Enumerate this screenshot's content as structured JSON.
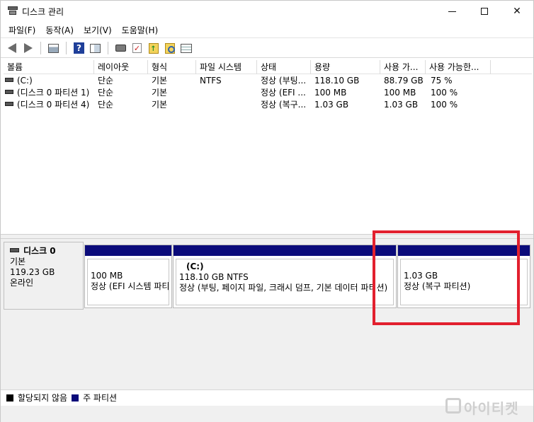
{
  "window": {
    "title": "디스크 관리",
    "controls": {
      "minimize": "—",
      "maximize": "☐",
      "close": "✕"
    }
  },
  "menu": [
    "파일(F)",
    "동작(A)",
    "보기(V)",
    "도움말(H)"
  ],
  "toolbar": {
    "icons": [
      "back-arrow-icon",
      "forward-arrow-icon",
      "console-tree-icon",
      "help-icon",
      "properties-icon",
      "connect-disk-icon",
      "check-icon",
      "up-folder-icon",
      "find-folder-icon",
      "list-view-icon"
    ]
  },
  "volume_list": {
    "columns": [
      "볼륨",
      "레이아웃",
      "형식",
      "파일 시스템",
      "상태",
      "용량",
      "사용 가...",
      "사용 가능한..."
    ],
    "rows": [
      [
        "(C:)",
        "단순",
        "기본",
        "NTFS",
        "정상 (부팅...",
        "118.10 GB",
        "88.79 GB",
        "75 %"
      ],
      [
        "(디스크 0 파티션 1)",
        "단순",
        "기본",
        "",
        "정상 (EFI ...",
        "100 MB",
        "100 MB",
        "100 %"
      ],
      [
        "(디스크 0 파티션 4)",
        "단순",
        "기본",
        "",
        "정상 (복구...",
        "1.03 GB",
        "1.03 GB",
        "100 %"
      ]
    ]
  },
  "disk": {
    "name": "디스크 0",
    "type": "기본",
    "size": "119.23 GB",
    "status": "온라인",
    "partitions": [
      {
        "name": "",
        "size": "100 MB",
        "status": "정상 (EFI 시스템 파티션)"
      },
      {
        "name": "(C:)",
        "size": "118.10 GB NTFS",
        "status": "정상 (부팅, 페이지 파일, 크래시 덤프, 기본 데이터 파티션)"
      },
      {
        "name": "",
        "size": "1.03 GB",
        "status": "정상 (복구 파티션)"
      }
    ]
  },
  "legend": {
    "unallocated": "할당되지 않음",
    "primary": "주 파티션",
    "colors": {
      "unallocated": "#000000",
      "primary": "#0b0b7a"
    }
  },
  "watermark": {
    "text": "아이티켓"
  },
  "highlight": {
    "color": "#e2202e"
  }
}
